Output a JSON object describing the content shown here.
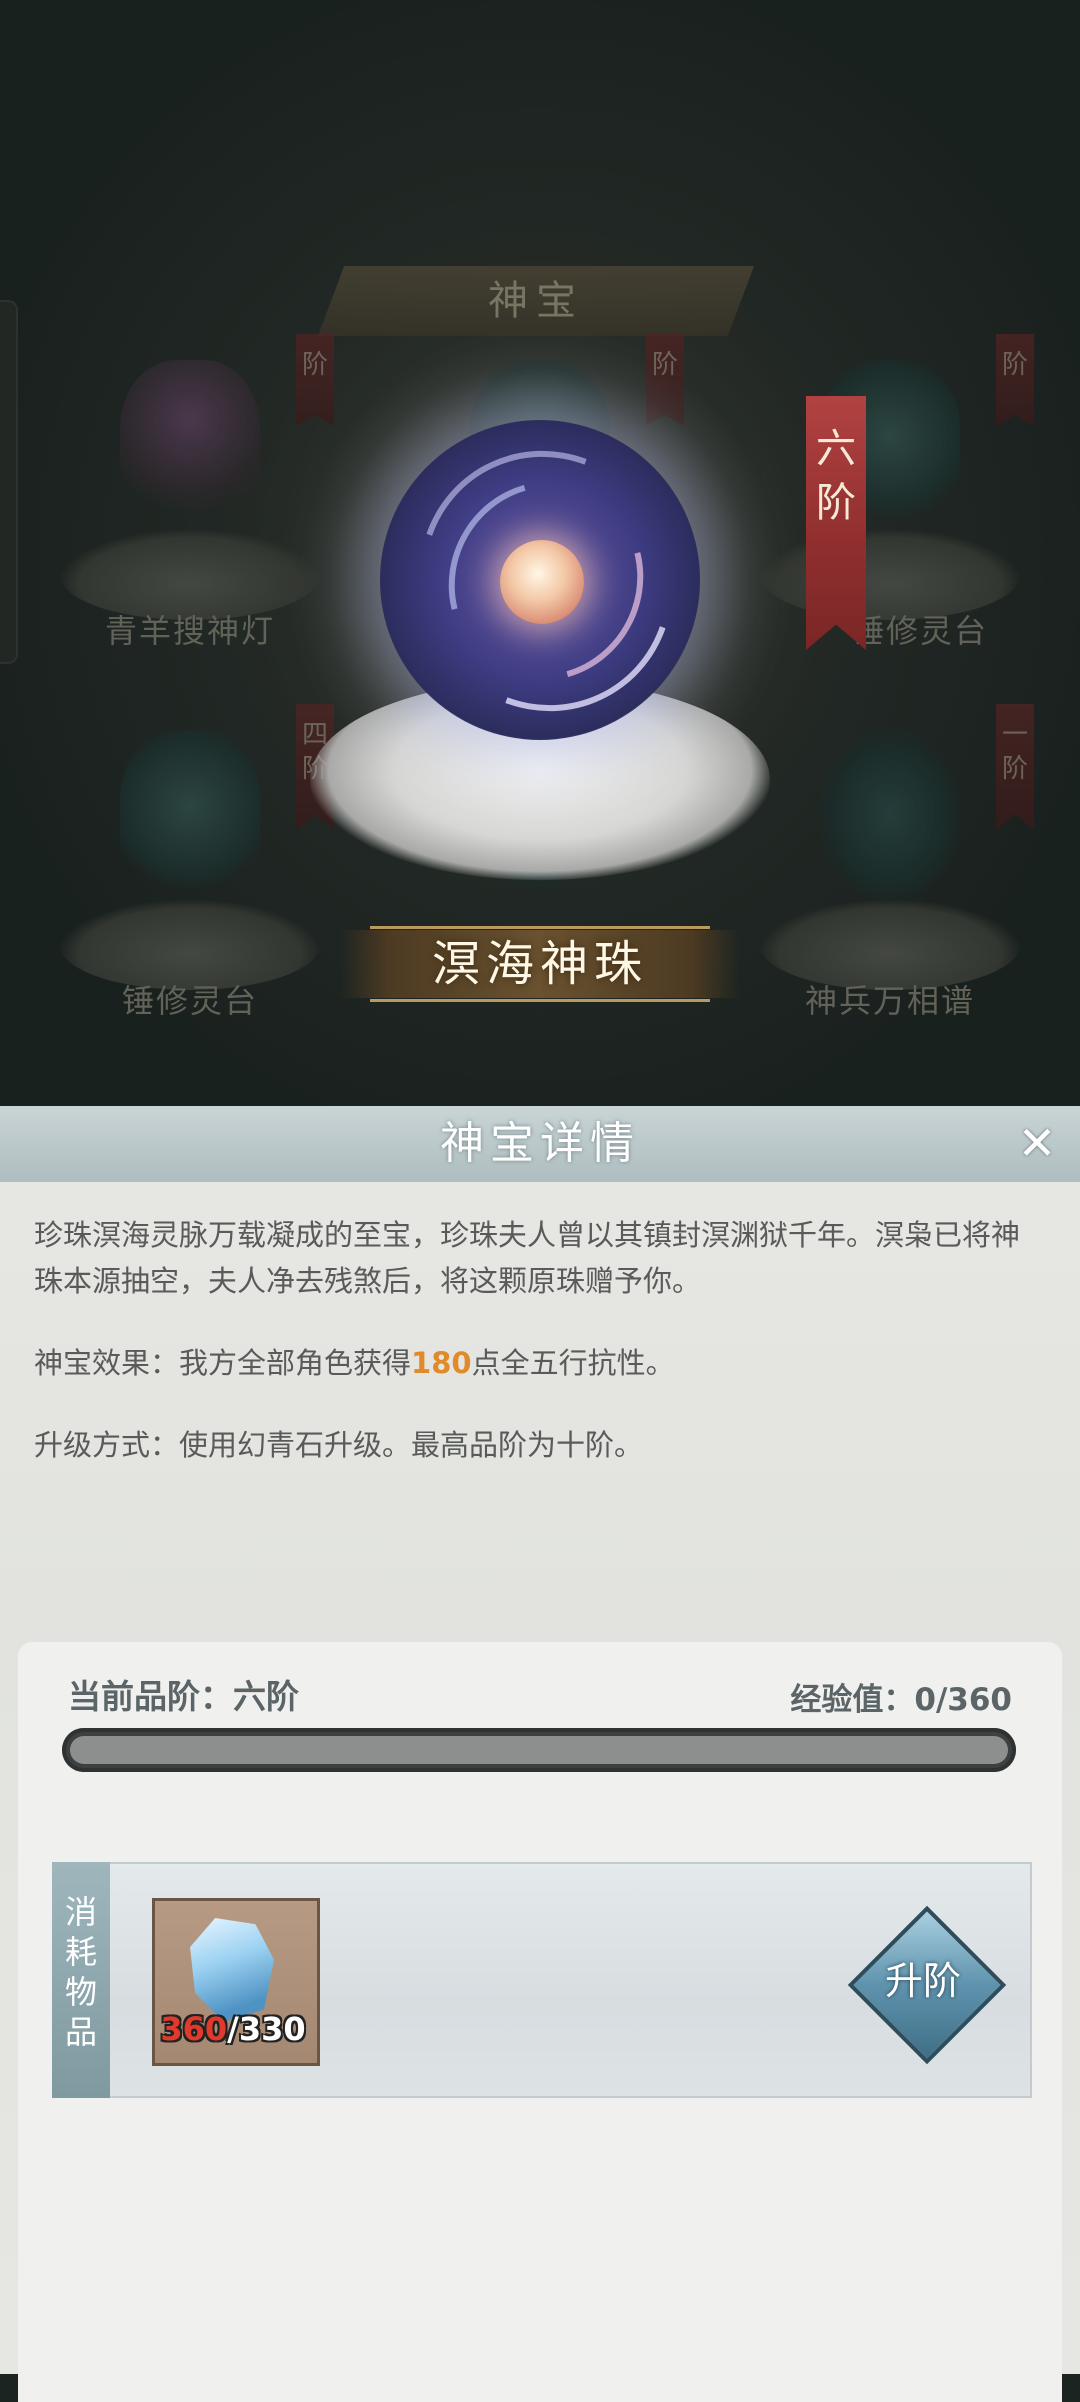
{
  "header": {
    "title": "神宝"
  },
  "grid_items": [
    {
      "name": "青羊搜神灯",
      "rank": "阶"
    },
    {
      "name": "",
      "rank": "阶"
    },
    {
      "name": "锤修灵台",
      "rank": "阶"
    },
    {
      "name": "锤修灵台",
      "rank": "四阶"
    },
    {
      "name": "",
      "rank": "六阶"
    },
    {
      "name": "神兵万相谱",
      "rank": "一阶"
    }
  ],
  "focus_item": {
    "name": "溟海神珠",
    "rank": "六阶"
  },
  "detail": {
    "title": "神宝详情",
    "close_icon": "close-icon",
    "description": "珍珠溟海灵脉万载凝成的至宝，珍珠夫人曾以其镇封溟渊狱千年。溟枭已将神珠本源抽空，夫人净去残煞后，将这颗原珠赠予你。",
    "effect_prefix": "神宝效果：我方全部角色获得",
    "effect_value": "180",
    "effect_suffix": "点全五行抗性。",
    "upgrade_method": "升级方式：使用幻青石升级。最高品阶为十阶。"
  },
  "progress": {
    "current_rank_label": "当前品阶：六阶",
    "exp_label": "经验值：0/360",
    "exp_current": 0,
    "exp_max": 360
  },
  "cost": {
    "side_label_chars": [
      "消",
      "耗",
      "物",
      "品"
    ],
    "item_icon": "blue-stone-icon",
    "item_have": "360",
    "item_need": "/330",
    "upgrade_button": "升阶"
  },
  "colors": {
    "highlight": "#e08a2a",
    "rank_ribbon": "#b24242",
    "header_bar": "#b4c3c6"
  }
}
